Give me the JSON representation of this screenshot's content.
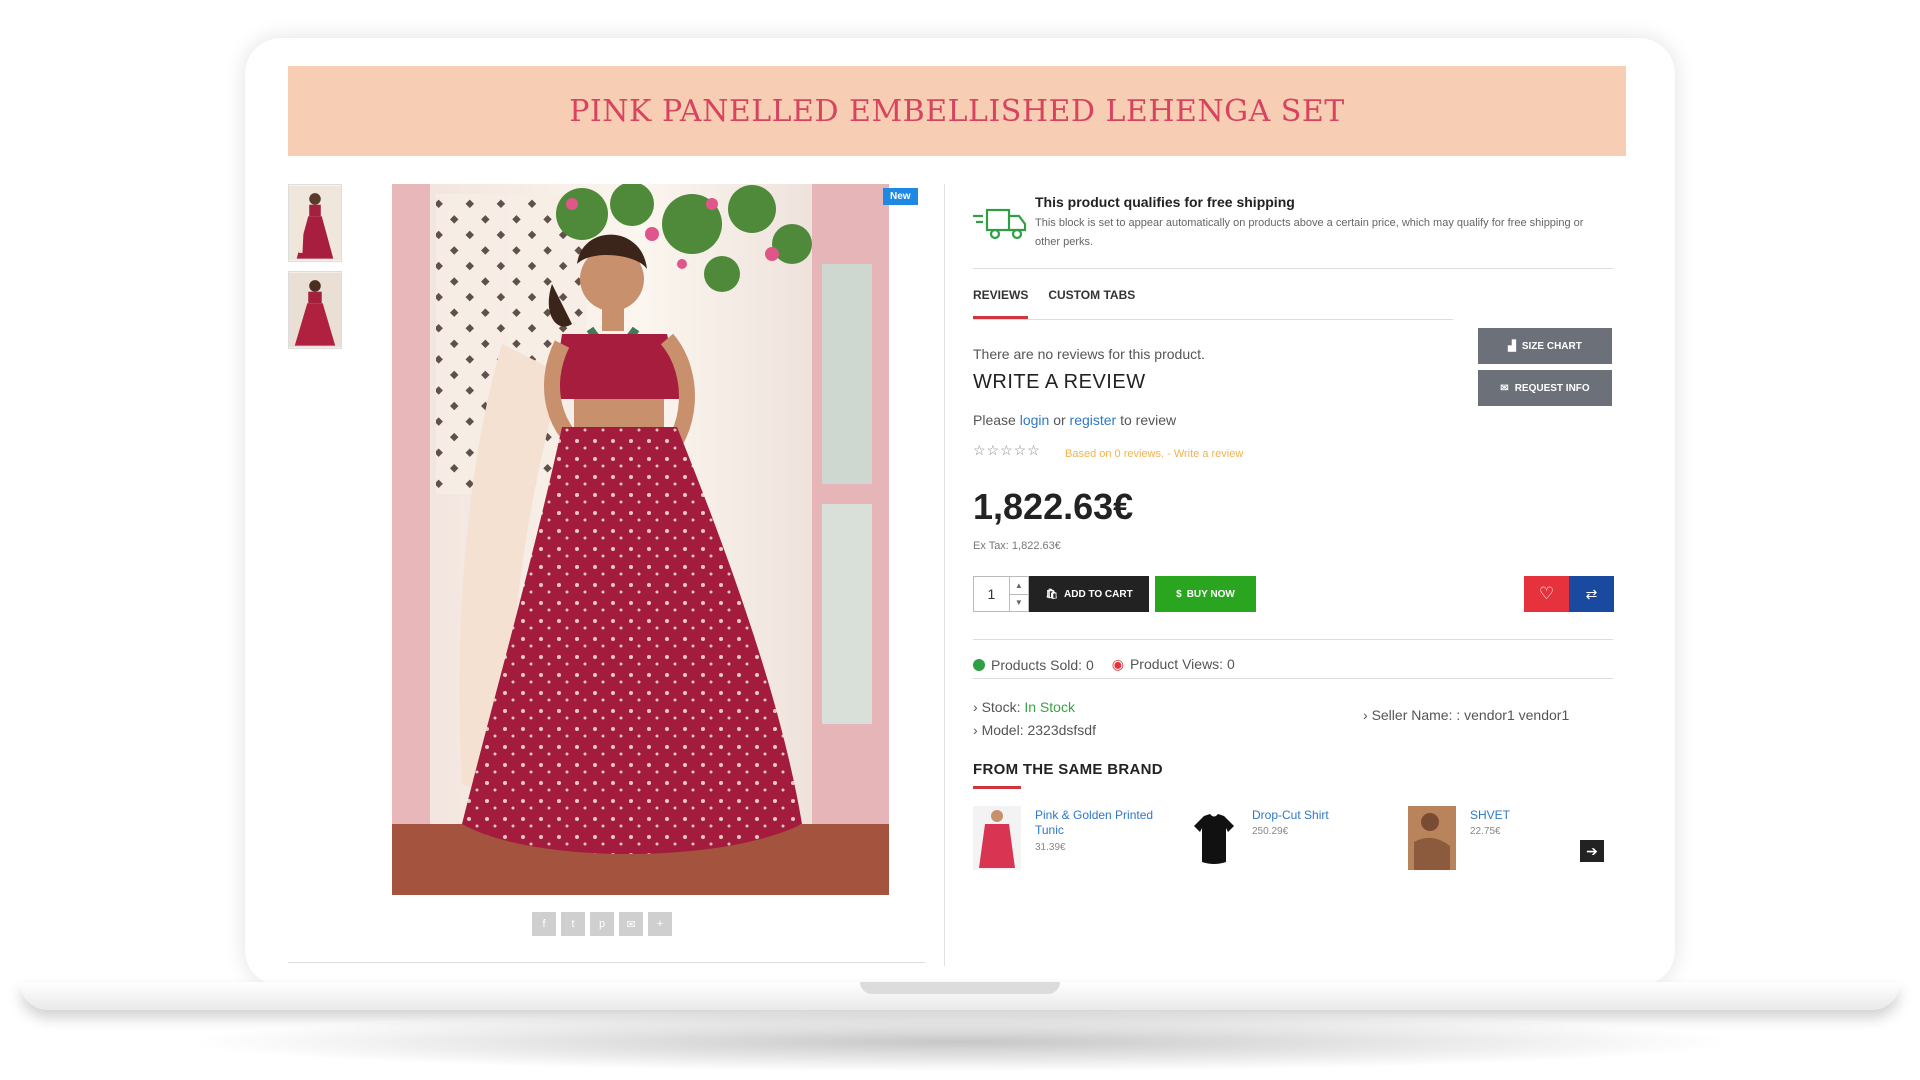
{
  "product": {
    "title": "PINK PANELLED EMBELLISHED LEHENGA SET",
    "badge": "New",
    "price": "1,822.63€",
    "ex_tax": "Ex Tax: 1,822.63€"
  },
  "shipping": {
    "title": "This product qualifies for free shipping",
    "description": "This block is set to appear automatically on products above a certain price, which may qualify for free shipping or other perks."
  },
  "tabs": [
    {
      "label": "REVIEWS",
      "active": true
    },
    {
      "label": "CUSTOM TABS",
      "active": false
    }
  ],
  "side_buttons": {
    "size_chart": "SIZE CHART",
    "request_info": "REQUEST INFO"
  },
  "reviews": {
    "none_text": "There are no reviews for this product.",
    "write_heading": "WRITE A REVIEW",
    "please": "Please",
    "login": "login",
    "or": "or",
    "register": "register",
    "to_review": "to review",
    "stars": "☆☆☆☆☆",
    "summary": "Based on 0 reviews. - Write a review"
  },
  "cart": {
    "quantity": "1",
    "add_to_cart": "ADD TO CART",
    "buy_now": "BUY NOW"
  },
  "stats": {
    "sold": "Products Sold: 0",
    "views": "Product Views: 0"
  },
  "details": {
    "stock_label": "Stock:",
    "stock_value": "In Stock",
    "model": "Model: 2323dsfsdf",
    "seller": "Seller Name: : vendor1 vendor1"
  },
  "brand": {
    "heading": "FROM THE SAME BRAND",
    "items": [
      {
        "name": "Pink & Golden Printed Tunic",
        "price": "31.39€"
      },
      {
        "name": "Drop-Cut Shirt",
        "price": "250.29€"
      },
      {
        "name": "SHVET",
        "price": "22.75€"
      }
    ]
  },
  "share_icons": [
    "facebook-icon",
    "twitter-icon",
    "pinterest-icon",
    "email-icon",
    "plus-icon"
  ],
  "colors": {
    "banner_bg": "#f7cdb3",
    "title": "#d8445f",
    "accent_red": "#e5323d",
    "buy_green": "#29a51f",
    "compare_blue": "#1a49a0",
    "link_blue": "#2e78c9"
  }
}
